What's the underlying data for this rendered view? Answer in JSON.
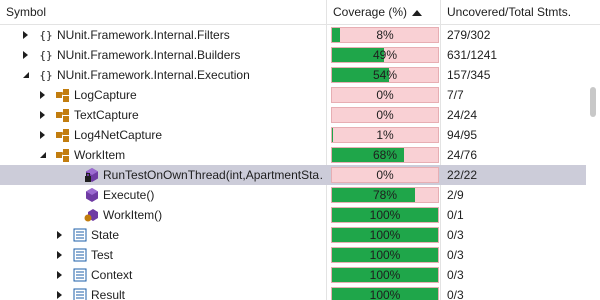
{
  "header": {
    "symbol": "Symbol",
    "coverage": "Coverage (%)",
    "uncovered": "Uncovered/Total Stmts."
  },
  "colors": {
    "covered": "#1fa64a",
    "uncovered": "#f9d0d4",
    "selected": "#ccccd9"
  },
  "rows": [
    {
      "label": "NUnit.Framework.Internal.Filters",
      "icon": "namespace-icon",
      "expander": "collapsed",
      "coverage_text": "8%",
      "coverage": 8,
      "stmts": "279/302"
    },
    {
      "label": "NUnit.Framework.Internal.Builders",
      "icon": "namespace-icon",
      "expander": "collapsed",
      "coverage_text": "49%",
      "coverage": 49,
      "stmts": "631/1241"
    },
    {
      "label": "NUnit.Framework.Internal.Execution",
      "icon": "namespace-icon",
      "expander": "expanded",
      "coverage_text": "54%",
      "coverage": 54,
      "stmts": "157/345"
    },
    {
      "label": "LogCapture",
      "icon": "class-icon",
      "expander": "collapsed",
      "coverage_text": "0%",
      "coverage": 0,
      "stmts": "7/7"
    },
    {
      "label": "TextCapture",
      "icon": "class-icon",
      "expander": "collapsed",
      "coverage_text": "0%",
      "coverage": 0,
      "stmts": "24/24"
    },
    {
      "label": "Log4NetCapture",
      "icon": "class-icon",
      "expander": "collapsed",
      "coverage_text": "1%",
      "coverage": 1,
      "stmts": "94/95"
    },
    {
      "label": "WorkItem",
      "icon": "class-icon",
      "expander": "expanded",
      "coverage_text": "68%",
      "coverage": 68,
      "stmts": "24/76"
    },
    {
      "label": "RunTestOnOwnThread(int,ApartmentSta…",
      "icon": "private-method-icon",
      "expander": "none",
      "coverage_text": "0%",
      "coverage": 0,
      "stmts": "22/22",
      "selected": true
    },
    {
      "label": "Execute()",
      "icon": "method-icon",
      "expander": "none",
      "coverage_text": "78%",
      "coverage": 78,
      "stmts": "2/9"
    },
    {
      "label": "WorkItem()",
      "icon": "constructor-icon",
      "expander": "none",
      "coverage_text": "100%",
      "coverage": 100,
      "stmts": "0/1"
    },
    {
      "label": "State",
      "icon": "property-icon",
      "expander": "collapsed",
      "coverage_text": "100%",
      "coverage": 100,
      "stmts": "0/3"
    },
    {
      "label": "Test",
      "icon": "property-icon",
      "expander": "collapsed",
      "coverage_text": "100%",
      "coverage": 100,
      "stmts": "0/3"
    },
    {
      "label": "Context",
      "icon": "property-icon",
      "expander": "collapsed",
      "coverage_text": "100%",
      "coverage": 100,
      "stmts": "0/3"
    },
    {
      "label": "Result",
      "icon": "property-icon",
      "expander": "collapsed",
      "coverage_text": "100%",
      "coverage": 100,
      "stmts": "0/3"
    }
  ]
}
